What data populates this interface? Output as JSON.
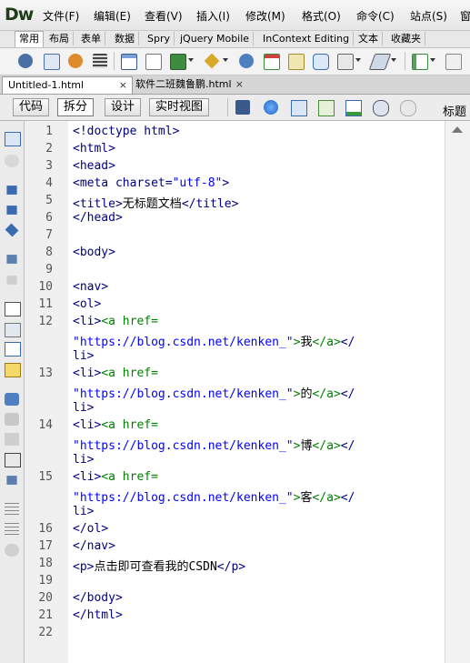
{
  "app": {
    "logo": "Dw"
  },
  "menu": [
    "文件(F)",
    "编辑(E)",
    "查看(V)",
    "插入(I)",
    "修改(M)",
    "格式(O)",
    "命令(C)",
    "站点(S)",
    "窗"
  ],
  "insert_tabs": [
    "常用",
    "布局",
    "表单",
    "数据",
    "Spry",
    "jQuery Mobile",
    "InContext Editing",
    "文本",
    "收藏夹"
  ],
  "insert_tabs_active": "常用",
  "toolbar_icons": [
    "hyperlink-icon",
    "email-link-icon",
    "named-anchor-icon",
    "horizontal-rule-icon",
    "table-icon",
    "insert-div-icon",
    "image-icon",
    "media-icon",
    "widget-icon",
    "date-icon",
    "server-side-include-icon",
    "comment-icon",
    "head-icon",
    "script-icon",
    "template-icon"
  ],
  "document_tabs": [
    {
      "label": "Untitled-1.html",
      "close": "×",
      "active": true
    },
    {
      "label": "软件二班魏鲁鹏.html",
      "close": "×",
      "active": false
    }
  ],
  "view_buttons": [
    "代码",
    "拆分",
    "设计",
    "实时视图"
  ],
  "view_active": "拆分",
  "title_label": "标题",
  "view_icons": [
    "multiscreen-icon",
    "preview-globe-icon",
    "file-management-icon",
    "browser-check-icon",
    "validate-icon",
    "visual-aids-icon",
    "refresh-icon"
  ],
  "left_tools": [
    "open-documents-icon",
    "show-code-navigator-icon",
    "collapse-full-tag-icon",
    "collapse-selection-icon",
    "expand-all-icon",
    "select-parent-tag-icon",
    "balance-braces-icon",
    "line-numbers-icon",
    "highlight-invalid-code-icon",
    "word-wrap-icon",
    "syntax-error-icon",
    "apply-comment-icon",
    "remove-comment-icon",
    "wrap-tag-icon",
    "recent-snippets-icon",
    "move-css-icon",
    "indent-code-icon",
    "outdent-code-icon",
    "format-source-icon"
  ],
  "code": {
    "line_numbers": [
      "1",
      "2",
      "3",
      "4",
      "5",
      "6",
      "7",
      "8",
      "9",
      "10",
      "11",
      "12",
      "",
      "",
      "13",
      "",
      "",
      "14",
      "",
      "",
      "15",
      "",
      "",
      "16",
      "17",
      "18",
      "19",
      "20",
      "21",
      "22"
    ],
    "lines": [
      [
        {
          "t": "<!doctype html>",
          "c": "tag"
        }
      ],
      [
        {
          "t": "<html>",
          "c": "tag"
        }
      ],
      [
        {
          "t": "<head>",
          "c": "tag"
        }
      ],
      [
        {
          "t": "<meta charset=",
          "c": "tag"
        },
        {
          "t": "\"utf-8\"",
          "c": "str"
        },
        {
          "t": ">",
          "c": "tag"
        }
      ],
      [
        {
          "t": "<title>",
          "c": "tag"
        },
        {
          "t": "无标题文档",
          "c": "txt"
        },
        {
          "t": "</title>",
          "c": "tag"
        }
      ],
      [
        {
          "t": "</head>",
          "c": "tag"
        }
      ],
      [],
      [
        {
          "t": "<body>",
          "c": "tag"
        }
      ],
      [],
      [
        {
          "t": "<nav>",
          "c": "tag"
        }
      ],
      [
        {
          "t": "<ol>",
          "c": "tag"
        }
      ],
      [
        {
          "t": "<li>",
          "c": "tag"
        },
        {
          "t": "<a href=",
          "c": "atag"
        }
      ],
      [
        {
          "t": "\"https://blog.csdn.net/kenken_\"",
          "c": "str"
        },
        {
          "t": ">",
          "c": "atag"
        },
        {
          "t": "我",
          "c": "txt"
        },
        {
          "t": "</a>",
          "c": "atag"
        },
        {
          "t": "</",
          "c": "tag"
        }
      ],
      [
        {
          "t": "li>",
          "c": "tag"
        }
      ],
      [
        {
          "t": "<li>",
          "c": "tag"
        },
        {
          "t": "<a href=",
          "c": "atag"
        }
      ],
      [
        {
          "t": "\"https://blog.csdn.net/kenken_\"",
          "c": "str"
        },
        {
          "t": ">",
          "c": "atag"
        },
        {
          "t": "的",
          "c": "txt"
        },
        {
          "t": "</a>",
          "c": "atag"
        },
        {
          "t": "</",
          "c": "tag"
        }
      ],
      [
        {
          "t": "li>",
          "c": "tag"
        }
      ],
      [
        {
          "t": "<li>",
          "c": "tag"
        },
        {
          "t": "<a href=",
          "c": "atag"
        }
      ],
      [
        {
          "t": "\"https://blog.csdn.net/kenken_\"",
          "c": "str"
        },
        {
          "t": ">",
          "c": "atag"
        },
        {
          "t": "博",
          "c": "txt"
        },
        {
          "t": "</a>",
          "c": "atag"
        },
        {
          "t": "</",
          "c": "tag"
        }
      ],
      [
        {
          "t": "li>",
          "c": "tag"
        }
      ],
      [
        {
          "t": "<li>",
          "c": "tag"
        },
        {
          "t": "<a href=",
          "c": "atag"
        }
      ],
      [
        {
          "t": "\"https://blog.csdn.net/kenken_\"",
          "c": "str"
        },
        {
          "t": ">",
          "c": "atag"
        },
        {
          "t": "客",
          "c": "txt"
        },
        {
          "t": "</a>",
          "c": "atag"
        },
        {
          "t": "</",
          "c": "tag"
        }
      ],
      [
        {
          "t": "li>",
          "c": "tag"
        }
      ],
      [
        {
          "t": "</ol>",
          "c": "tag"
        }
      ],
      [
        {
          "t": "</nav>",
          "c": "tag"
        }
      ],
      [
        {
          "t": "<p>",
          "c": "tag"
        },
        {
          "t": "点击即可查看我的CSDN",
          "c": "txt"
        },
        {
          "t": "</p>",
          "c": "tag"
        }
      ],
      [],
      [
        {
          "t": "</body>",
          "c": "tag"
        }
      ],
      [
        {
          "t": "</html>",
          "c": "tag"
        }
      ],
      []
    ]
  },
  "colors": {
    "tag": "#000080",
    "attr_value": "#0000ff",
    "anchor_tag": "#008000",
    "text": "#000000"
  }
}
